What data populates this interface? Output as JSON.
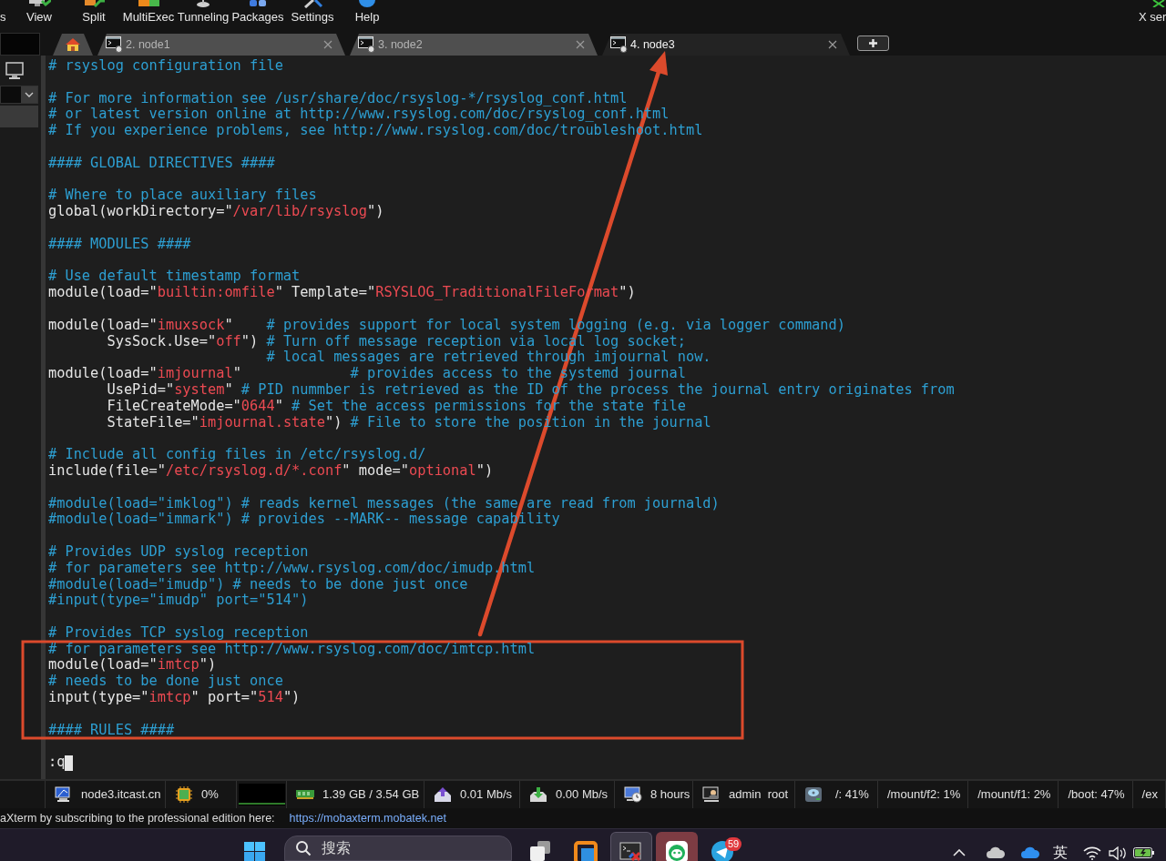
{
  "toolbar": {
    "items": [
      {
        "label": "s"
      },
      {
        "label": "View"
      },
      {
        "label": "Split"
      },
      {
        "label": "MultiExec"
      },
      {
        "label": "Tunneling"
      },
      {
        "label": "Packages"
      },
      {
        "label": "Settings"
      },
      {
        "label": "Help"
      }
    ],
    "right_item": {
      "label": "X ser"
    }
  },
  "tabs": [
    {
      "kind": "home",
      "selected": false
    },
    {
      "kind": "session",
      "label": "2. node1",
      "selected": false
    },
    {
      "kind": "session",
      "label": "3. node2",
      "selected": false
    },
    {
      "kind": "session",
      "label": "4. node3",
      "selected": true
    }
  ],
  "terminal": {
    "blocks": [
      [
        [
          {
            "kind": "comment",
            "text": "# rsyslog configuration file"
          }
        ]
      ],
      [
        [
          {
            "kind": "comment",
            "text": "# For more information see /usr/share/doc/rsyslog-*/rsyslog_conf.html"
          }
        ],
        [
          {
            "kind": "comment",
            "text": "# or latest version online at http://www.rsyslog.com/doc/rsyslog_conf.html"
          }
        ],
        [
          {
            "kind": "comment",
            "text": "# If you experience problems, see http://www.rsyslog.com/doc/troubleshoot.html"
          }
        ]
      ],
      [
        [
          {
            "kind": "comment",
            "text": "#### GLOBAL DIRECTIVES ####"
          }
        ]
      ],
      [
        [
          {
            "kind": "comment",
            "text": "# Where to place auxiliary files"
          }
        ],
        [
          {
            "kind": "code",
            "text": "global(workDirectory=\""
          },
          {
            "kind": "string",
            "text": "/var/lib/rsyslog"
          },
          {
            "kind": "code",
            "text": "\")"
          }
        ]
      ],
      [
        [
          {
            "kind": "comment",
            "text": "#### MODULES ####"
          }
        ]
      ],
      [
        [
          {
            "kind": "comment",
            "text": "# Use default timestamp format"
          }
        ],
        [
          {
            "kind": "code",
            "text": "module(load=\""
          },
          {
            "kind": "string",
            "text": "builtin:omfile"
          },
          {
            "kind": "code",
            "text": "\" Template=\""
          },
          {
            "kind": "string",
            "text": "RSYSLOG_TraditionalFileFormat"
          },
          {
            "kind": "code",
            "text": "\")"
          }
        ]
      ],
      [
        [
          {
            "kind": "code",
            "text": "module(load=\""
          },
          {
            "kind": "string",
            "text": "imuxsock"
          },
          {
            "kind": "code",
            "text": "\"    "
          },
          {
            "kind": "comment",
            "text": "# provides support for local system logging (e.g. via logger command)"
          }
        ],
        [
          {
            "kind": "code",
            "text": "       SysSock.Use=\""
          },
          {
            "kind": "string",
            "text": "off"
          },
          {
            "kind": "code",
            "text": "\") "
          },
          {
            "kind": "comment",
            "text": "# Turn off message reception via local log socket;"
          }
        ],
        [
          {
            "kind": "comment",
            "text": "                          # local messages are retrieved through imjournal now."
          }
        ],
        [
          {
            "kind": "code",
            "text": "module(load=\""
          },
          {
            "kind": "string",
            "text": "imjournal"
          },
          {
            "kind": "code",
            "text": "\"             "
          },
          {
            "kind": "comment",
            "text": "# provides access to the systemd journal"
          }
        ],
        [
          {
            "kind": "code",
            "text": "       UsePid=\""
          },
          {
            "kind": "string",
            "text": "system"
          },
          {
            "kind": "code",
            "text": "\" "
          },
          {
            "kind": "comment",
            "text": "# PID nummber is retrieved as the ID of the process the journal entry originates from"
          }
        ],
        [
          {
            "kind": "code",
            "text": "       FileCreateMode=\""
          },
          {
            "kind": "string",
            "text": "0644"
          },
          {
            "kind": "code",
            "text": "\" "
          },
          {
            "kind": "comment",
            "text": "# Set the access permissions for the state file"
          }
        ],
        [
          {
            "kind": "code",
            "text": "       StateFile=\""
          },
          {
            "kind": "string",
            "text": "imjournal.state"
          },
          {
            "kind": "code",
            "text": "\") "
          },
          {
            "kind": "comment",
            "text": "# File to store the position in the journal"
          }
        ]
      ],
      [
        [
          {
            "kind": "comment",
            "text": "# Include all config files in /etc/rsyslog.d/"
          }
        ],
        [
          {
            "kind": "code",
            "text": "include(file=\""
          },
          {
            "kind": "string",
            "text": "/etc/rsyslog.d/*.conf"
          },
          {
            "kind": "code",
            "text": "\" mode=\""
          },
          {
            "kind": "string",
            "text": "optional"
          },
          {
            "kind": "code",
            "text": "\")"
          }
        ]
      ],
      [
        [
          {
            "kind": "comment",
            "text": "#module(load=\"imklog\") # reads kernel messages (the same are read from journald)"
          }
        ],
        [
          {
            "kind": "comment",
            "text": "#module(load=\"immark\") # provides --MARK-- message capability"
          }
        ]
      ],
      [
        [
          {
            "kind": "comment",
            "text": "# Provides UDP syslog reception"
          }
        ],
        [
          {
            "kind": "comment",
            "text": "# for parameters see http://www.rsyslog.com/doc/imudp.html"
          }
        ],
        [
          {
            "kind": "comment",
            "text": "#module(load=\"imudp\") # needs to be done just once"
          }
        ],
        [
          {
            "kind": "comment",
            "text": "#input(type=\"imudp\" port=\"514\")"
          }
        ]
      ],
      [
        [
          {
            "kind": "comment",
            "text": "# Provides TCP syslog reception"
          }
        ],
        [
          {
            "kind": "comment",
            "text": "# for parameters see http://www.rsyslog.com/doc/imtcp.html"
          }
        ],
        [
          {
            "kind": "code",
            "text": "module(load=\""
          },
          {
            "kind": "string",
            "text": "imtcp"
          },
          {
            "kind": "code",
            "text": "\")"
          }
        ],
        [
          {
            "kind": "comment",
            "text": "# needs to be done just once"
          }
        ],
        [
          {
            "kind": "code",
            "text": "input(type=\""
          },
          {
            "kind": "string",
            "text": "imtcp"
          },
          {
            "kind": "code",
            "text": "\" port=\""
          },
          {
            "kind": "string",
            "text": "514"
          },
          {
            "kind": "code",
            "text": "\")"
          }
        ]
      ],
      [
        [
          {
            "kind": "comment",
            "text": "#### RULES ####"
          }
        ]
      ]
    ],
    "command_line": {
      "text": ":q",
      "cursor": true
    }
  },
  "status_bar": {
    "items": [
      {
        "kind": "host",
        "text": "node3.itcast.cn"
      },
      {
        "kind": "cpu",
        "text": "0%"
      },
      {
        "kind": "cpu_graph"
      },
      {
        "kind": "memory",
        "text": "1.39 GB / 3.54 GB"
      },
      {
        "kind": "upload",
        "text": "0.01 Mb/s"
      },
      {
        "kind": "download",
        "text": "0.00 Mb/s"
      },
      {
        "kind": "uptime",
        "text": "8 hours"
      },
      {
        "kind": "user",
        "text": "admin  root"
      },
      {
        "kind": "disk",
        "text": "/: 41%"
      },
      {
        "kind": "mount",
        "text": "/mount/f2: 1%"
      },
      {
        "kind": "mount",
        "text": "/mount/f1: 2%"
      },
      {
        "kind": "mount",
        "text": "/boot: 47%"
      },
      {
        "kind": "mount",
        "text": "/ex"
      },
      {
        "kind": "extra"
      }
    ]
  },
  "message_bar": {
    "text": "aXterm by subscribing to the professional edition here:",
    "link": "https://mobaxterm.mobatek.net"
  },
  "taskbar": {
    "search": {
      "placeholder": "搜索"
    },
    "apps": [
      {
        "kind": "task_view",
        "focused": false,
        "flashing": false
      },
      {
        "kind": "window_app",
        "focused": false,
        "flashing": false
      },
      {
        "kind": "terminal",
        "focused": true,
        "flashing": false
      },
      {
        "kind": "mascot",
        "focused": false,
        "flashing": true
      },
      {
        "kind": "messenger",
        "focused": false,
        "flashing": false,
        "badge": "59"
      }
    ],
    "tray": {
      "ime": "英"
    }
  }
}
